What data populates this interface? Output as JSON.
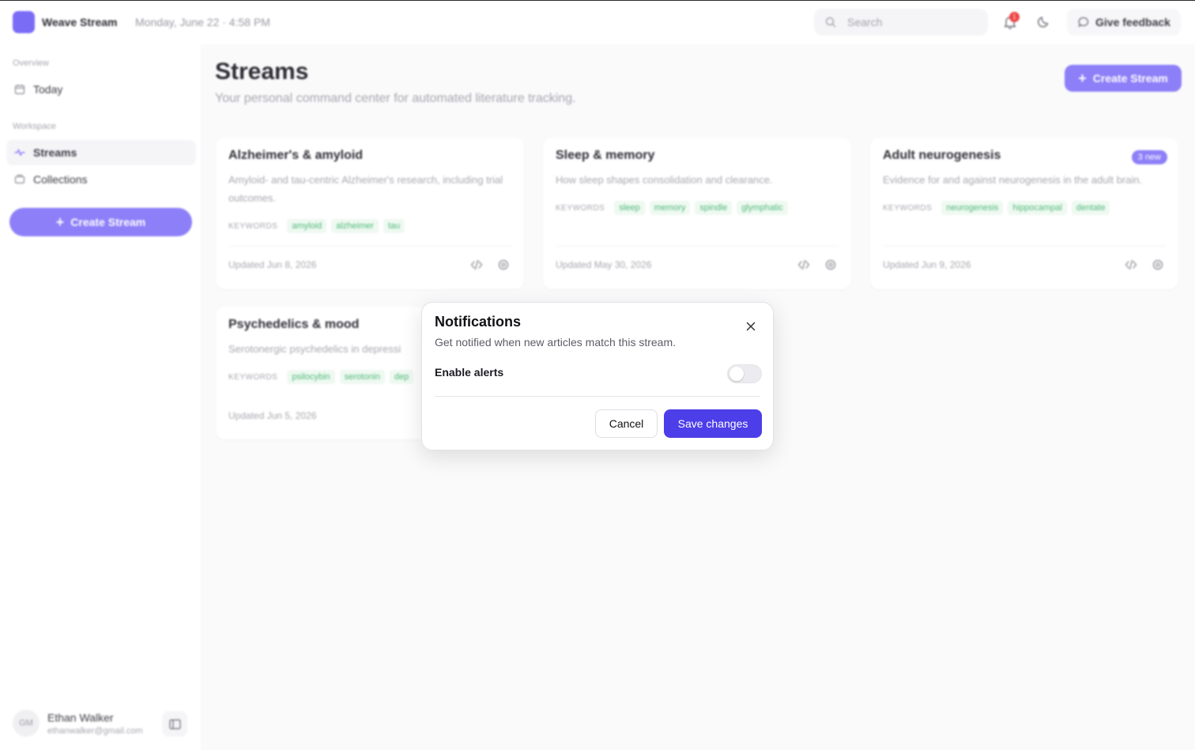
{
  "app": {
    "name": "Weave Stream",
    "datetime": "Monday, June 22 · 4:58 PM",
    "search_placeholder": "Search",
    "notification_count": "1",
    "feedback_label": "Give feedback",
    "accent_color": "#8d7ff8"
  },
  "sidebar": {
    "overview_label": "Overview",
    "today_label": "Today",
    "workspace_label": "Workspace",
    "streams_label": "Streams",
    "collections_label": "Collections",
    "create_label": "Create Stream",
    "user": {
      "initials": "GM",
      "name": "Ethan Walker",
      "email": "ethanwalker@gmail.com"
    }
  },
  "main": {
    "title": "Streams",
    "subtitle": "Your personal command center for automated literature tracking.",
    "create_label": "Create Stream",
    "keywords_label": "KEYWORDS",
    "cards": [
      {
        "title": "Alzheimer's & amyloid",
        "description": "Amyloid- and tau-centric Alzheimer's research, including trial outcomes.",
        "keywords": [
          "amyloid",
          "alzheimer",
          "tau"
        ],
        "updated": "Updated Jun 8, 2026"
      },
      {
        "title": "Sleep & memory",
        "description": "How sleep shapes consolidation and clearance.",
        "keywords": [
          "sleep",
          "memory",
          "spindle",
          "glymphatic"
        ],
        "updated": "Updated May 30, 2026"
      },
      {
        "title": "Adult neurogenesis",
        "badge": "3 new",
        "description": "Evidence for and against neurogenesis in the adult brain.",
        "keywords": [
          "neurogenesis",
          "hippocampal",
          "dentate"
        ],
        "updated": "Updated Jun 9, 2026"
      },
      {
        "title": "Psychedelics & mood",
        "description": "Serotonergic psychedelics in depressi",
        "keywords": [
          "psilocybin",
          "serotonin",
          "dep"
        ],
        "updated": "Updated Jun 5, 2026"
      }
    ]
  },
  "dialog": {
    "title": "Notifications",
    "subtitle": "Get notified when new articles match this stream.",
    "toggle_label": "Enable alerts",
    "toggle_on": false,
    "cancel_label": "Cancel",
    "save_label": "Save changes",
    "save_color": "#4c3ee8"
  }
}
